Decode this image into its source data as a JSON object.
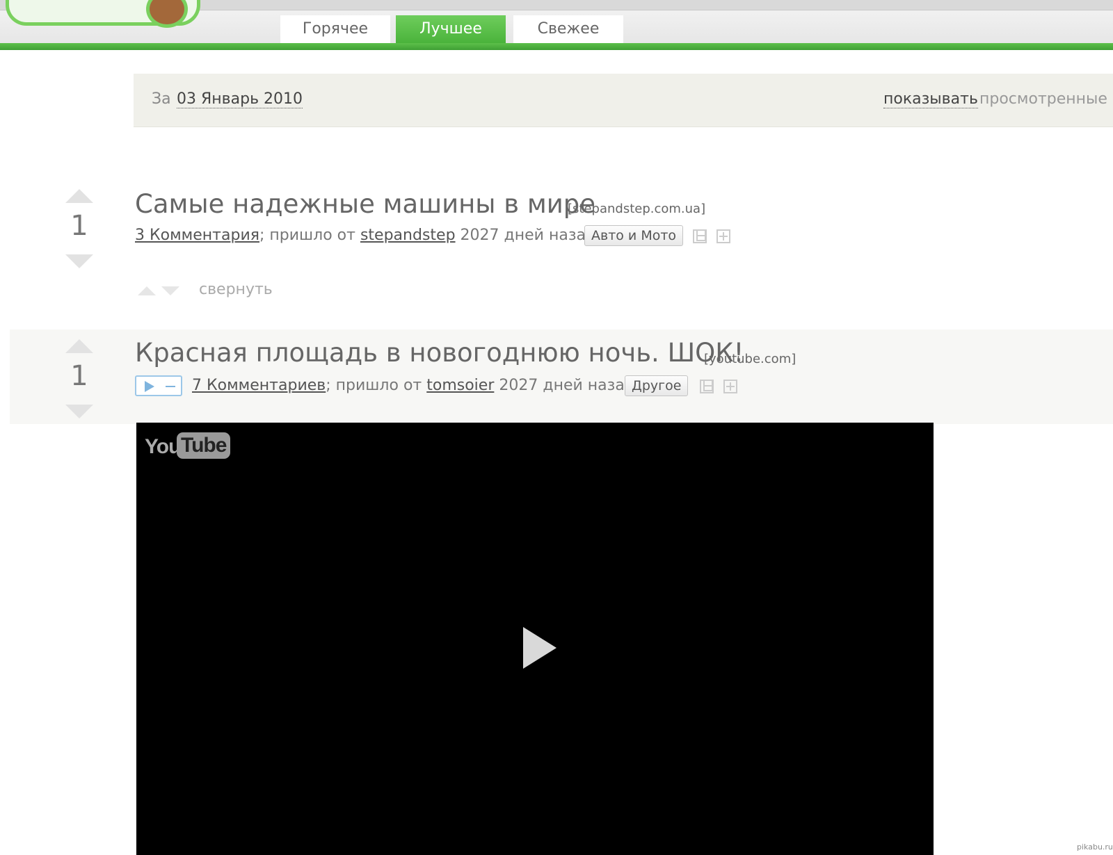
{
  "nav": {
    "tabs": [
      {
        "label": "Горячее",
        "active": false
      },
      {
        "label": "Лучшее",
        "active": true
      },
      {
        "label": "Свежее",
        "active": false
      }
    ]
  },
  "datebar": {
    "prefix": "За",
    "date": "03 Январь 2010",
    "show_link": "показывать",
    "seen_text": "просмотренные г"
  },
  "posts": [
    {
      "score": "1",
      "title": "Самые надежные машины в мире",
      "domain": "[stepandstep.com.ua]",
      "comments": "3 Комментария",
      "from_text": "; пришло от",
      "author": "stepandstep",
      "age": "2027 дней назад",
      "tag": "Авто и Мото",
      "collapse": "свернуть"
    },
    {
      "score": "1",
      "title": "Красная площадь в новогоднюю ночь. ШОК!",
      "domain": "[youtube.com]",
      "comments": "7 Комментариев",
      "from_text": "; пришло от",
      "author": "tomsoier",
      "age": "2027 дней назад",
      "tag": "Другое"
    }
  ],
  "video": {
    "logo_you": "You",
    "logo_tube": "Tube"
  },
  "watermark": "pikabu.ru",
  "colors": {
    "accent_green": "#4ab33b",
    "video_bg": "#000000"
  }
}
